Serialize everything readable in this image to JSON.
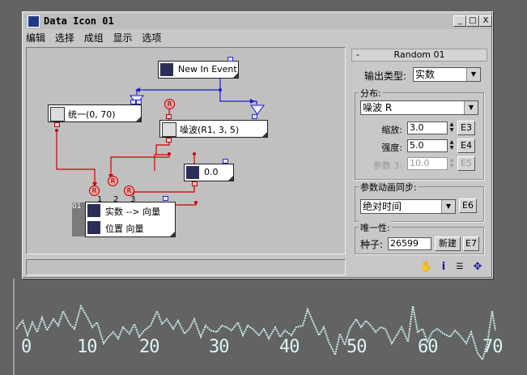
{
  "window": {
    "title": "Data Icon 01",
    "controls": [
      "_",
      "□",
      "X"
    ]
  },
  "menu": [
    "编辑",
    "选择",
    "成组",
    "显示",
    "选项"
  ],
  "graph": {
    "nodes": {
      "event": "New In Event",
      "uniform": "统一(0, 70)",
      "noise": "噪波(R1, 3, 5)",
      "number": "0.0",
      "output1": "实数 --> 向量",
      "output2": "位置 向量",
      "output_prefix": "01"
    },
    "r_labels": [
      "R",
      "R",
      "R",
      "R"
    ],
    "port_numbers": [
      "1",
      "2",
      "3"
    ],
    "icons": [
      "event-icon",
      "dice-icon",
      "dice-icon",
      "hash-icon",
      "vector-icon",
      "position-icon"
    ]
  },
  "panel": {
    "rollout_title": "Random 01",
    "rollout_toggle": "-",
    "output_type_label": "输出类型:",
    "output_type_value": "实数",
    "distribution": {
      "title": "分布:",
      "type_value": "噪波 R",
      "scale_label": "缩放:",
      "scale_value": "3.0",
      "scale_button": "E3",
      "strength_label": "强度:",
      "strength_value": "5.0",
      "strength_button": "E4",
      "param3_label": "参数 3:",
      "param3_value": "10.0",
      "param3_button": "E5"
    },
    "sync": {
      "title": "参数动画同步:",
      "value": "绝对时间",
      "button": "E6"
    },
    "uniqueness": {
      "title": "唯一性:",
      "seed_label": "种子:",
      "seed_value": "26599",
      "new_button": "新建",
      "button": "E7"
    }
  },
  "status_icons": [
    "hand-icon",
    "info-icon",
    "list-icon",
    "move-icon"
  ],
  "viewport": {
    "axis_labels": [
      "0",
      "10",
      "20",
      "30",
      "40",
      "50",
      "60",
      "70"
    ],
    "colors": {
      "curve": "#c9ecec",
      "background": "#636363"
    }
  },
  "colors": {
    "wire_red": "#d00000",
    "wire_blue": "#1a1ad0",
    "node_bg": "#ffffff",
    "window_bg": "#c8c8c8"
  }
}
